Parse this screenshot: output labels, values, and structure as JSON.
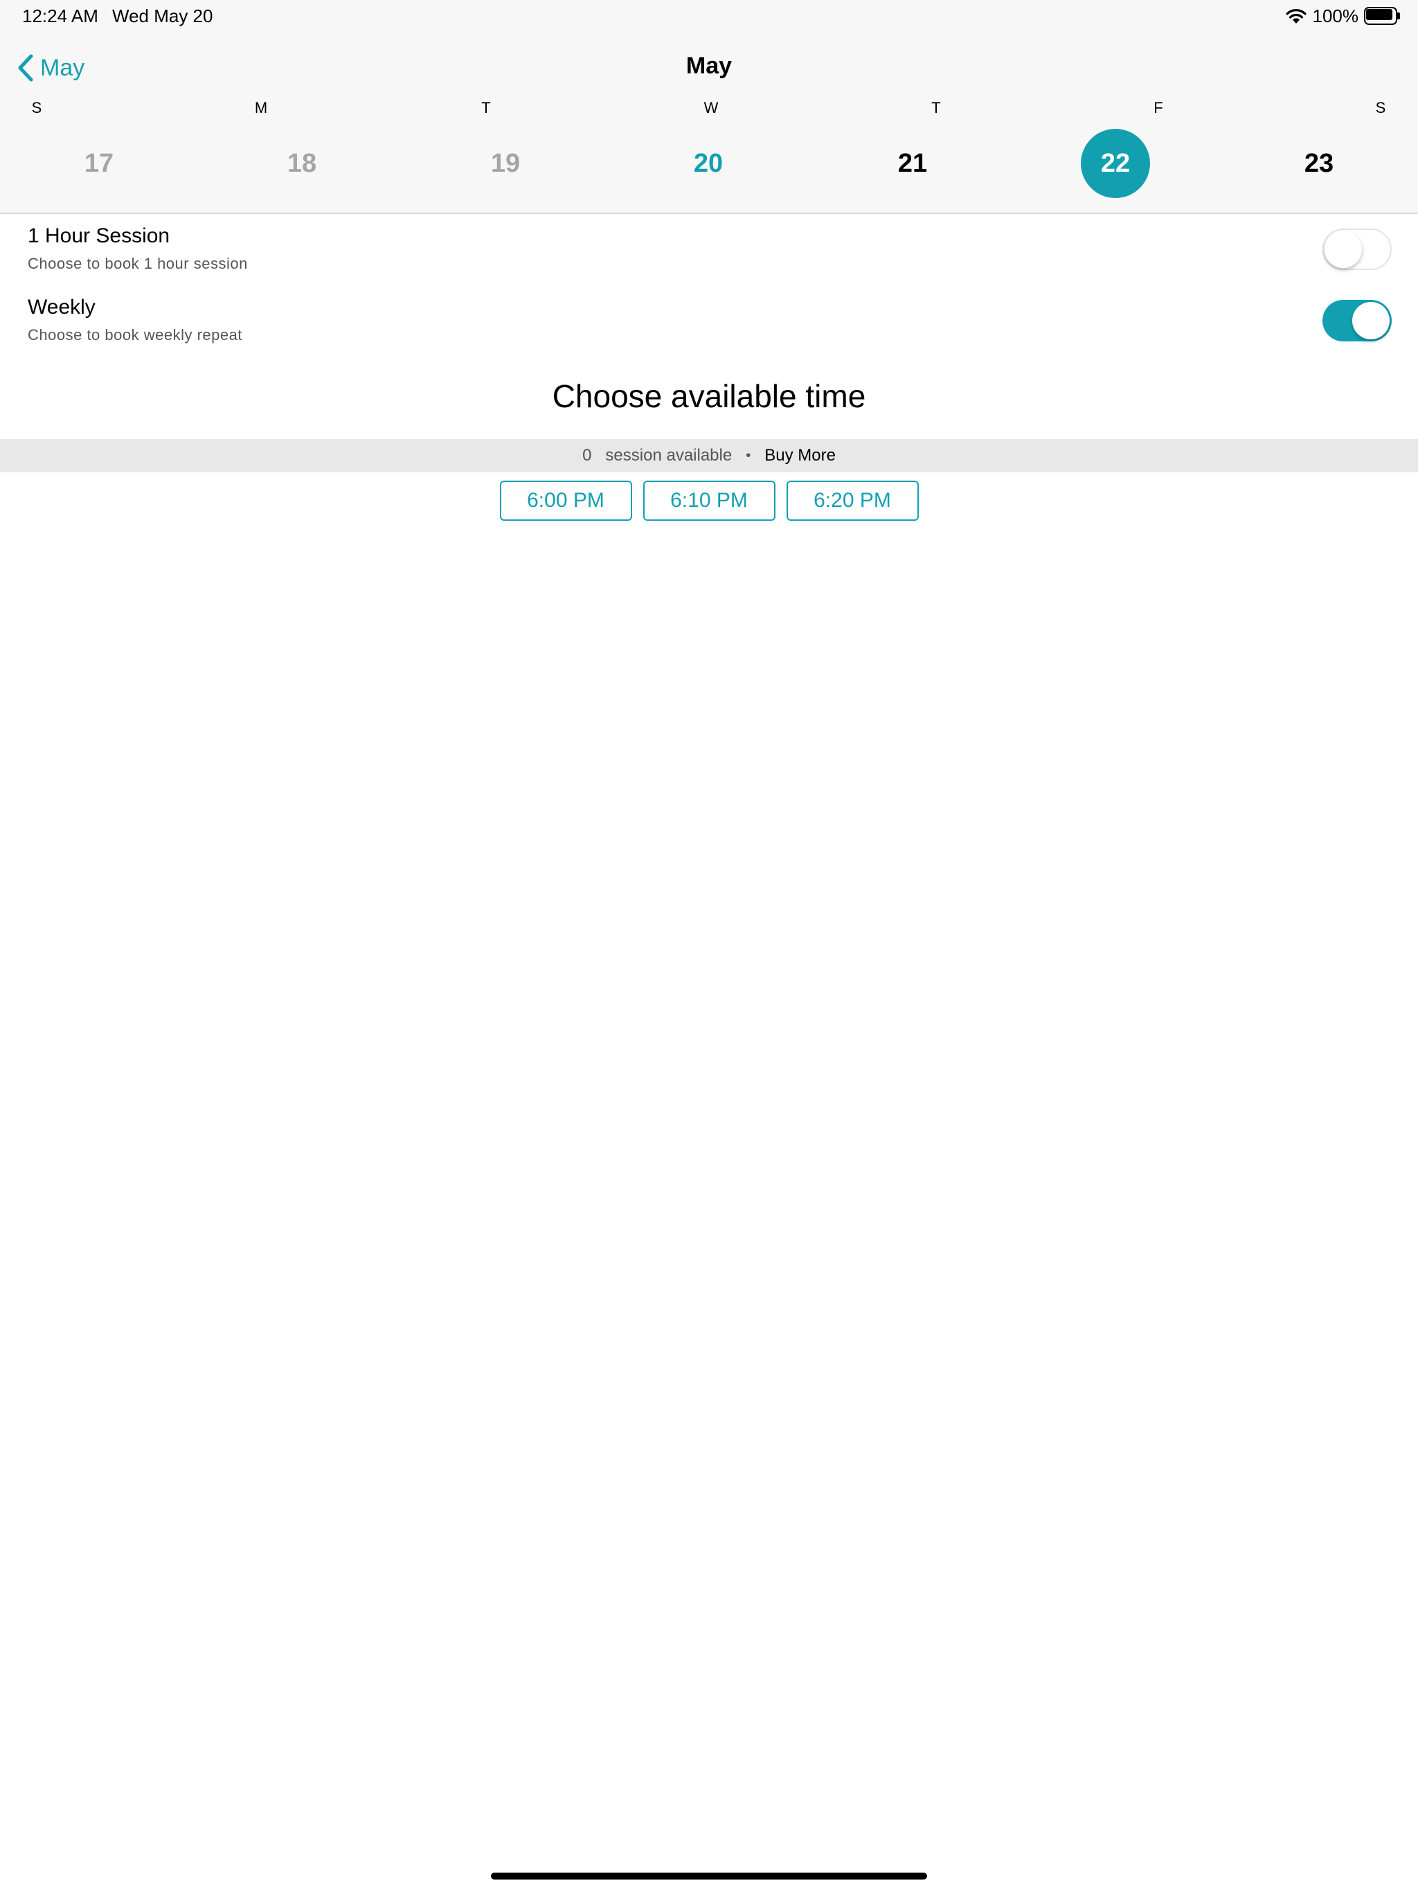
{
  "status_bar": {
    "time": "12:24 AM",
    "date": "Wed May 20",
    "battery": "100%",
    "icons": [
      "wifi-icon",
      "battery-icon"
    ]
  },
  "nav": {
    "back_label": "May",
    "title": "May",
    "back_icon": "chevron-left-icon"
  },
  "calendar": {
    "weekdays": [
      "S",
      "M",
      "T",
      "W",
      "T",
      "F",
      "S"
    ],
    "days": [
      {
        "label": "17",
        "state": "past"
      },
      {
        "label": "18",
        "state": "past"
      },
      {
        "label": "19",
        "state": "past"
      },
      {
        "label": "20",
        "state": "today"
      },
      {
        "label": "21",
        "state": "future"
      },
      {
        "label": "22",
        "state": "selected"
      },
      {
        "label": "23",
        "state": "future"
      }
    ]
  },
  "options": {
    "hour_session": {
      "title": "1 Hour Session",
      "subtitle": "Choose to book 1 hour session",
      "enabled": false
    },
    "weekly": {
      "title": "Weekly",
      "subtitle": "Choose to book weekly repeat",
      "enabled": true
    }
  },
  "booking": {
    "heading": "Choose available time",
    "session_count": "0",
    "session_label": "session available",
    "separator": "•",
    "buy_more": "Buy More",
    "slots": [
      "6:00 PM",
      "6:10 PM",
      "6:20 PM"
    ]
  },
  "colors": {
    "accent": "#12a0b1",
    "past_day": "#a5a5a5",
    "header_bg": "#f7f7f7",
    "bar_bg": "#e8e8e9"
  }
}
